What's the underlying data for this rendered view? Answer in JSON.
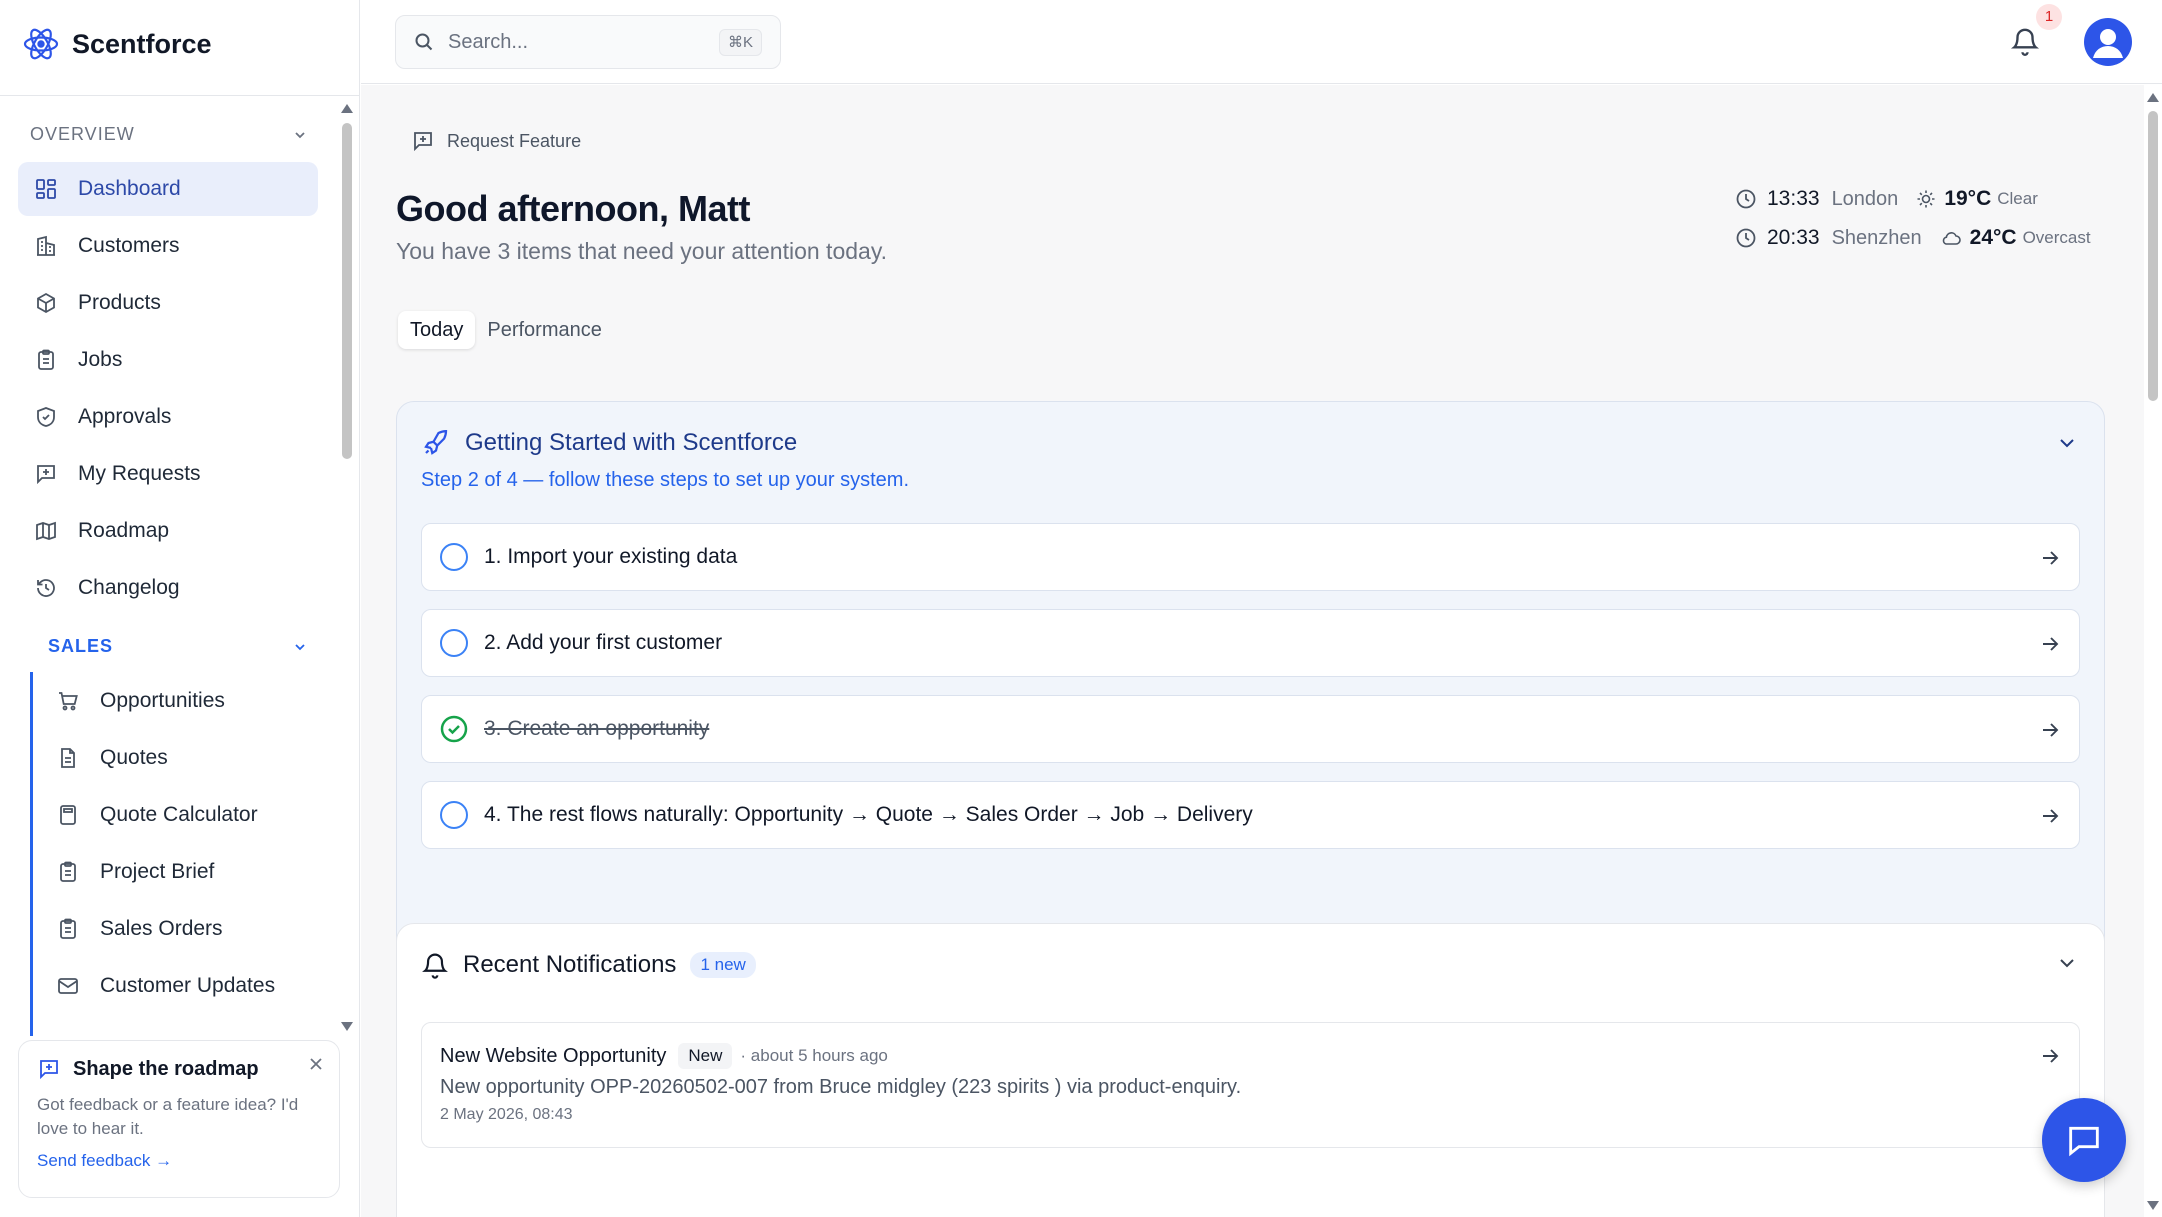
{
  "app": {
    "name": "Scentforce"
  },
  "search": {
    "placeholder": "Search...",
    "shortcut": "⌘K"
  },
  "notifications": {
    "badge": "1"
  },
  "sidebar": {
    "overview_label": "OVERVIEW",
    "overview_items": [
      {
        "label": "Dashboard",
        "icon": "dashboard-icon"
      },
      {
        "label": "Customers",
        "icon": "building-icon"
      },
      {
        "label": "Products",
        "icon": "box-icon"
      },
      {
        "label": "Jobs",
        "icon": "clipboard-icon"
      },
      {
        "label": "Approvals",
        "icon": "shield-check-icon"
      },
      {
        "label": "My Requests",
        "icon": "message-plus-icon"
      },
      {
        "label": "Roadmap",
        "icon": "map-icon"
      },
      {
        "label": "Changelog",
        "icon": "history-icon"
      }
    ],
    "sales_label": "SALES",
    "sales_items": [
      {
        "label": "Opportunities",
        "icon": "cart-icon"
      },
      {
        "label": "Quotes",
        "icon": "document-icon"
      },
      {
        "label": "Quote Calculator",
        "icon": "calculator-icon"
      },
      {
        "label": "Project Brief",
        "icon": "clipboard-icon"
      },
      {
        "label": "Sales Orders",
        "icon": "clipboard-icon"
      },
      {
        "label": "Customer Updates",
        "icon": "mail-icon"
      }
    ],
    "feedback": {
      "title": "Shape the roadmap",
      "text": "Got feedback or a feature idea? I'd love to hear it.",
      "link": "Send feedback →"
    }
  },
  "main": {
    "request_feature": "Request Feature",
    "greeting": "Good afternoon, Matt",
    "subtitle": "You have 3 items that need your attention today.",
    "clocks": [
      {
        "time": "13:33",
        "city": "London",
        "temp": "19°C",
        "condition": "Clear",
        "weather_icon": "sun-icon"
      },
      {
        "time": "20:33",
        "city": "Shenzhen",
        "temp": "24°C",
        "condition": "Overcast",
        "weather_icon": "cloud-icon"
      }
    ],
    "tabs": [
      "Today",
      "Performance"
    ],
    "getting_started": {
      "title": "Getting Started with Scentforce",
      "subtitle": "Step 2 of 4 — follow these steps to set up your system.",
      "steps": [
        {
          "label": "1. Import your existing data",
          "done": false
        },
        {
          "label": "2. Add your first customer",
          "done": false
        },
        {
          "label": "3. Create an opportunity",
          "done": true
        },
        {
          "label": "4. The rest flows naturally: Opportunity → Quote → Sales Order → Job → Delivery",
          "done": false
        }
      ]
    },
    "recent_notifications": {
      "title": "Recent Notifications",
      "count": "1 new",
      "items": [
        {
          "title": "New Website Opportunity",
          "tag": "New",
          "time": "· about 5 hours ago",
          "body": "New opportunity OPP-20260502-007 from Bruce midgley (223 spirits ) via product-enquiry.",
          "date": "2 May 2026, 08:43"
        }
      ]
    }
  },
  "colors": {
    "accent": "#2d55e8",
    "active_bg": "#e9eefb",
    "success": "#16a34a",
    "sales_accent": "#2563eb"
  }
}
